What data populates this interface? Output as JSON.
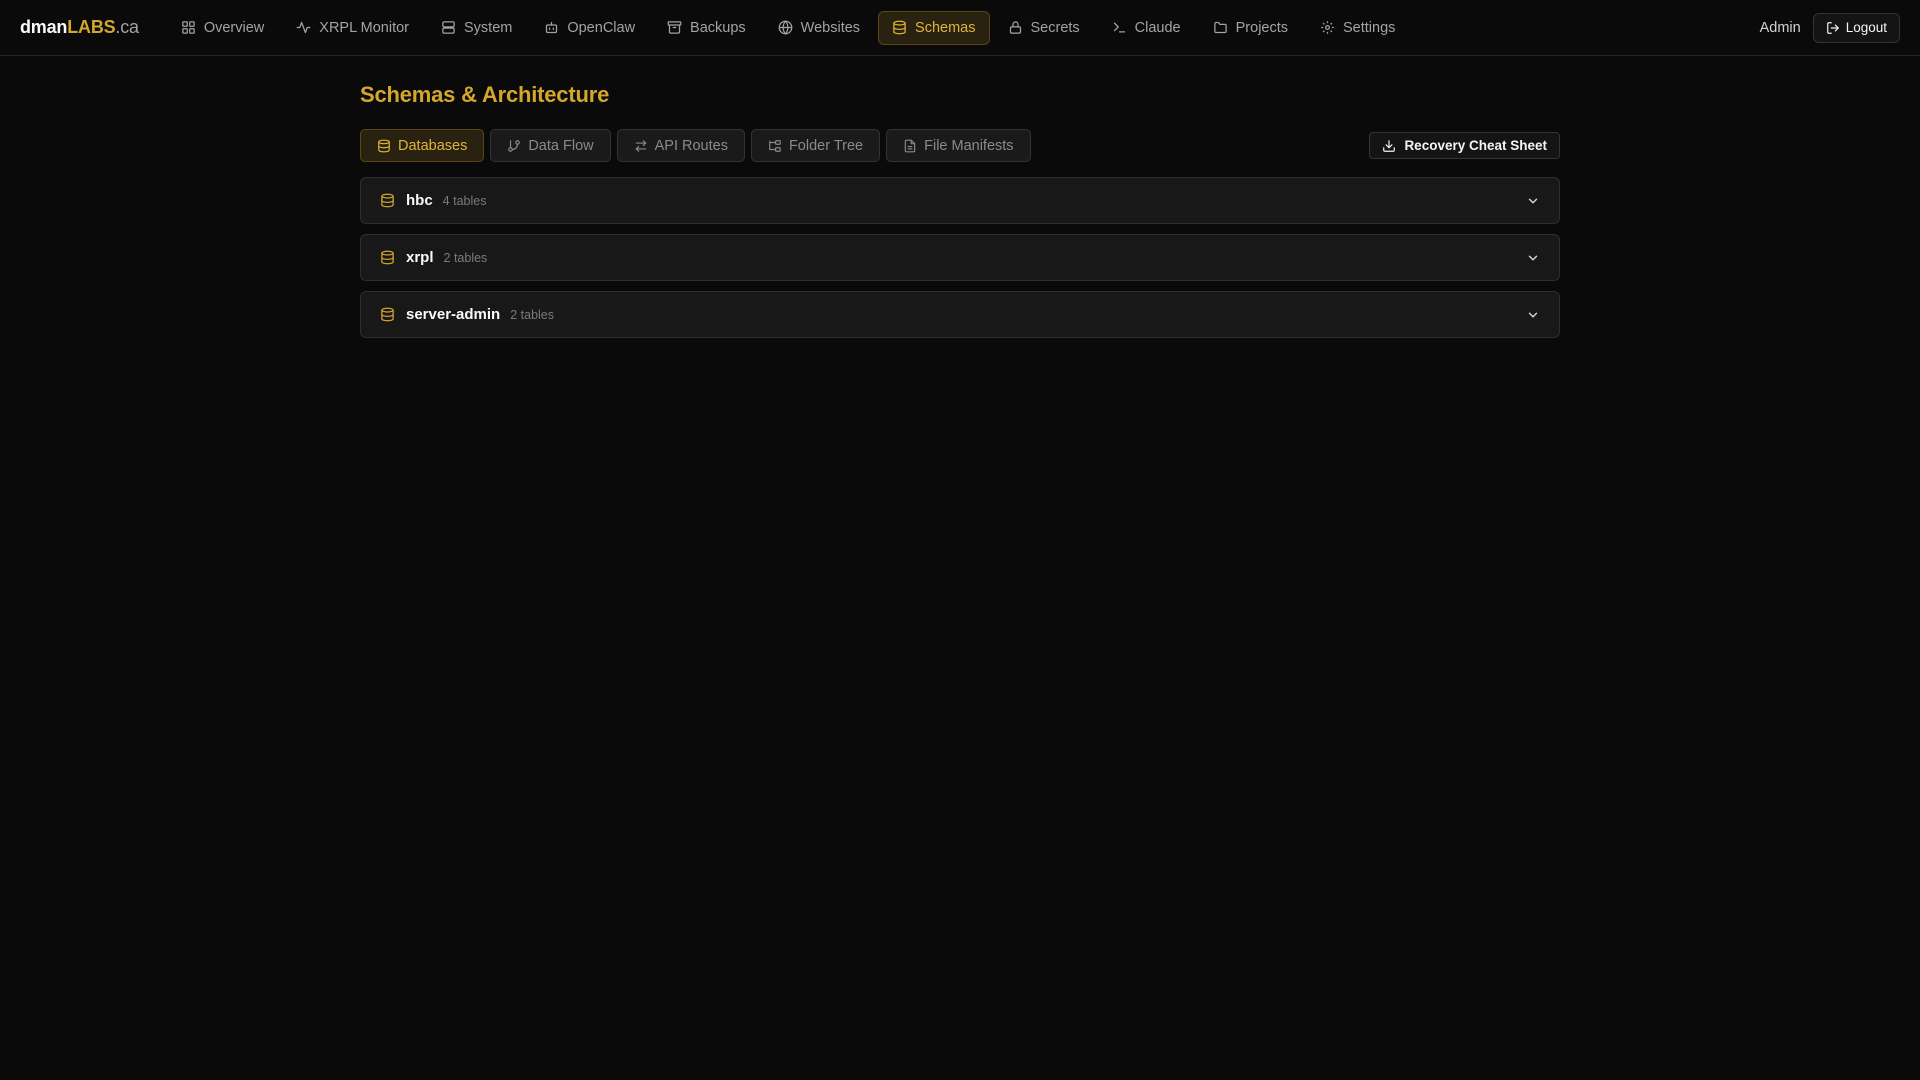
{
  "brand": {
    "part1": "dman",
    "part2": "LABS",
    "part3": ".ca"
  },
  "colors": {
    "accent": "#d4a72c",
    "background": "#0a0a0a",
    "card": "#181818"
  },
  "nav": {
    "items": [
      {
        "label": "Overview",
        "icon": "grid-icon"
      },
      {
        "label": "XRPL Monitor",
        "icon": "activity-icon"
      },
      {
        "label": "System",
        "icon": "server-icon"
      },
      {
        "label": "OpenClaw",
        "icon": "bot-icon"
      },
      {
        "label": "Backups",
        "icon": "archive-icon"
      },
      {
        "label": "Websites",
        "icon": "globe-icon"
      },
      {
        "label": "Schemas",
        "icon": "database-icon",
        "active": true
      },
      {
        "label": "Secrets",
        "icon": "lock-icon"
      },
      {
        "label": "Claude",
        "icon": "terminal-icon"
      },
      {
        "label": "Projects",
        "icon": "folder-icon"
      },
      {
        "label": "Settings",
        "icon": "gear-icon"
      }
    ],
    "user": "Admin",
    "logout_label": "Logout"
  },
  "page": {
    "title": "Schemas & Architecture",
    "tabs": [
      {
        "label": "Databases",
        "icon": "database-icon",
        "active": true
      },
      {
        "label": "Data Flow",
        "icon": "git-branch-icon"
      },
      {
        "label": "API Routes",
        "icon": "route-icon"
      },
      {
        "label": "Folder Tree",
        "icon": "folder-tree-icon"
      },
      {
        "label": "File Manifests",
        "icon": "file-text-icon"
      }
    ],
    "recovery_label": "Recovery Cheat Sheet",
    "databases": [
      {
        "name": "hbc",
        "tables": "4 tables"
      },
      {
        "name": "xrpl",
        "tables": "2 tables"
      },
      {
        "name": "server-admin",
        "tables": "2 tables"
      }
    ]
  }
}
